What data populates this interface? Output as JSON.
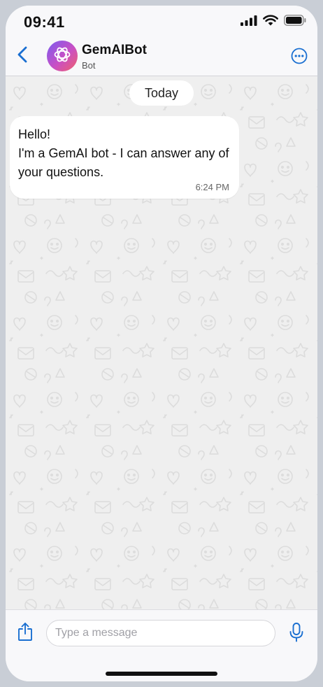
{
  "status_bar": {
    "time": "09:41",
    "icons": [
      "signal-icon",
      "wifi-icon",
      "battery-icon"
    ]
  },
  "header": {
    "back_icon": "chevron-left-icon",
    "avatar_icon": "openai-logo-icon",
    "title": "GemAIBot",
    "subtitle": "Bot",
    "more_icon": "ellipsis-circle-icon"
  },
  "chat": {
    "date_label": "Today",
    "messages": [
      {
        "lines": [
          "Hello!",
          "I'm a GemAI bot - I can answer any of",
          "your questions."
        ],
        "time": "6:24 PM"
      }
    ]
  },
  "input_bar": {
    "attach_icon": "share-upload-icon",
    "placeholder": "Type a message",
    "value": "",
    "mic_icon": "microphone-icon"
  },
  "colors": {
    "accent": "#1a6fd1",
    "chat_background": "#efefef",
    "bubble": "#ffffff",
    "avatar_gradient_start": "#7b5cf0",
    "avatar_gradient_end": "#f0606a"
  }
}
